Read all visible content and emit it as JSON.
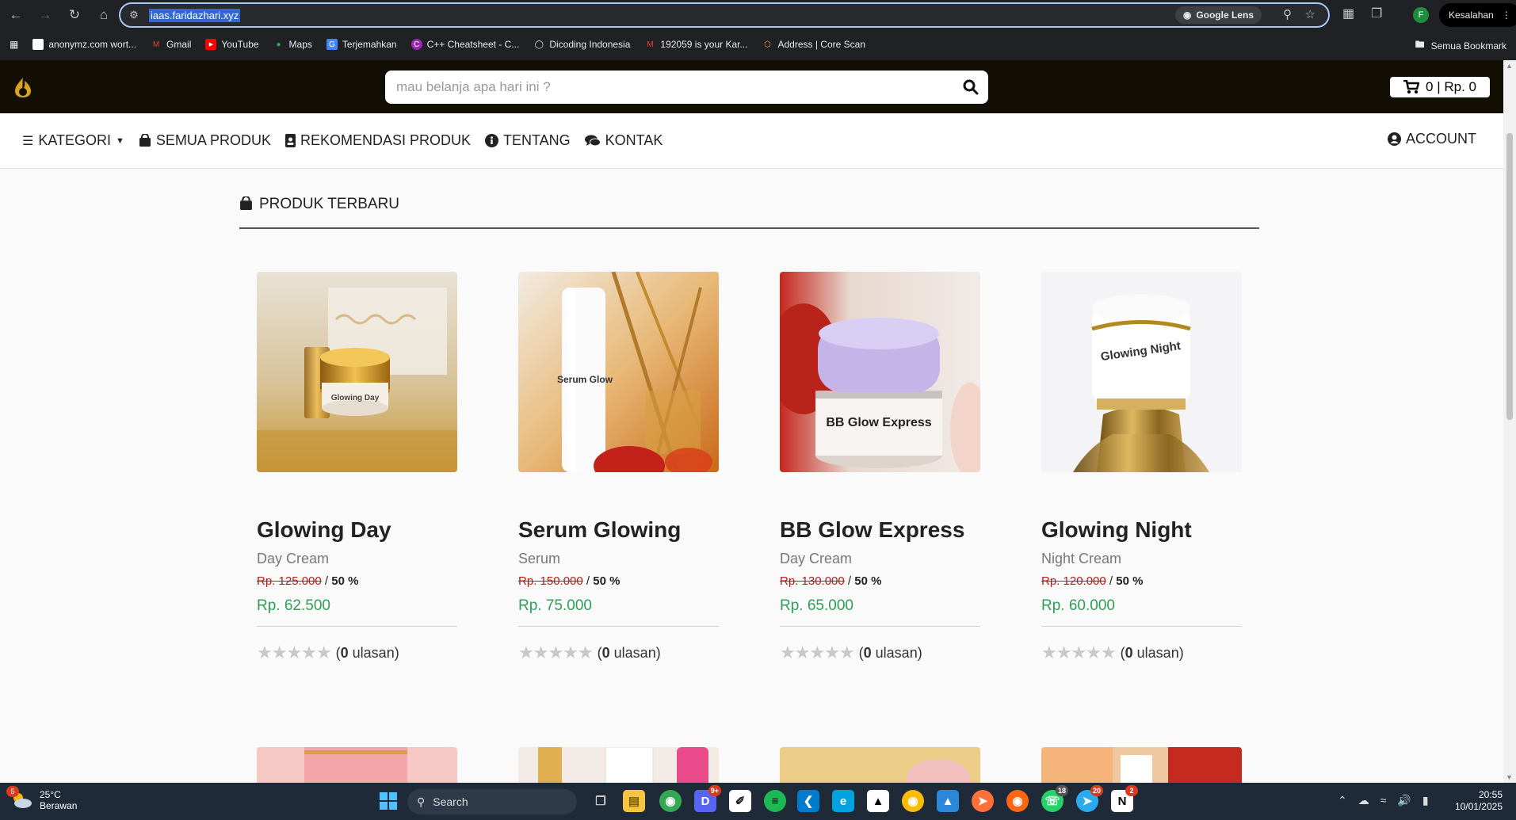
{
  "browser": {
    "url": "iaas.faridazhari.xyz",
    "lens_label": "Google Lens",
    "profile_initial": "F",
    "error_label": "Kesalahan",
    "bookmarks": [
      {
        "label": "anonymz.com wort...",
        "color": "#ffffff"
      },
      {
        "label": "Gmail",
        "color": "#ea4335"
      },
      {
        "label": "YouTube",
        "color": "#ff0000"
      },
      {
        "label": "Maps",
        "color": "#34a853"
      },
      {
        "label": "Terjemahkan",
        "color": "#4285f4"
      },
      {
        "label": "C++ Cheatsheet - C...",
        "color": "#9c27b0"
      },
      {
        "label": "Dicoding Indonesia",
        "color": "#e8eaed"
      },
      {
        "label": "192059 is your Kar...",
        "color": "#ea4335"
      },
      {
        "label": "Address | Core Scan",
        "color": "#f5a623"
      }
    ],
    "all_bookmarks_label": "Semua Bookmark"
  },
  "header": {
    "search_placeholder": "mau belanja apa hari ini ?",
    "cart_label": "0 | Rp. 0"
  },
  "nav": {
    "items": [
      {
        "label": "KATEGORI",
        "icon": "list-icon"
      },
      {
        "label": "SEMUA PRODUK",
        "icon": "shopping-bag-icon"
      },
      {
        "label": "REKOMENDASI PRODUK",
        "icon": "id-badge-icon"
      },
      {
        "label": "TENTANG",
        "icon": "info-icon"
      },
      {
        "label": "KONTAK",
        "icon": "chat-icon"
      }
    ],
    "account_label": "ACCOUNT"
  },
  "section": {
    "title": "PRODUK TERBARU"
  },
  "products": [
    {
      "name": "Glowing Day",
      "category": "Day Cream",
      "old_price": "Rp. 125.000",
      "discount": "50 %",
      "price": "Rp. 62.500",
      "reviews": "0",
      "image_label": "Glowing Day"
    },
    {
      "name": "Serum Glowing",
      "category": "Serum",
      "old_price": "Rp. 150.000",
      "discount": "50 %",
      "price": "Rp. 75.000",
      "reviews": "0",
      "image_label": "Serum Glow"
    },
    {
      "name": "BB Glow Express",
      "category": "Day Cream",
      "old_price": "Rp. 130.000",
      "discount": "50 %",
      "price": "Rp. 65.000",
      "reviews": "0",
      "image_label": "BB Glow Express"
    },
    {
      "name": "Glowing Night",
      "category": "Night Cream",
      "old_price": "Rp. 120.000",
      "discount": "50 %",
      "price": "Rp. 60.000",
      "reviews": "0",
      "image_label": "Glowing Night"
    }
  ],
  "rating": {
    "stars": "★★★★★",
    "reviews_word": "ulasan"
  },
  "taskbar": {
    "temperature": "25°C",
    "weather": "Berawan",
    "weather_badge": "5",
    "search_label": "Search",
    "time": "20:55",
    "date": "10/01/2025",
    "badges": {
      "discord": "9+",
      "whatsapp": "18",
      "telegram": "20",
      "notion": "2"
    }
  }
}
